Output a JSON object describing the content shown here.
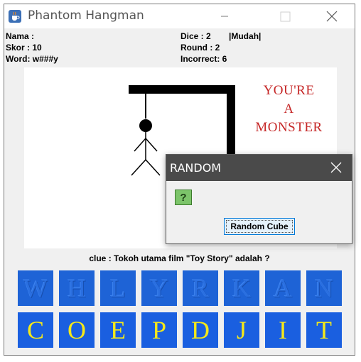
{
  "window": {
    "title": "Phantom Hangman",
    "icon": "java-cup-icon"
  },
  "info": {
    "nama": "Nama :",
    "skor": "Skor : 10",
    "word": "Word: w###y",
    "dice": "Dice : 2",
    "difficulty": "|Mudah|",
    "round": "Round : 2",
    "incorrect": "Incorrect: 6"
  },
  "canvas": {
    "message_lines": [
      "YOU'RE",
      "A",
      "MONSTER"
    ]
  },
  "clue": "clue : Tokoh utama film \"Toy Story\" adalah ?",
  "letters": {
    "row1": [
      "W",
      "H",
      "L",
      "Y",
      "R",
      "K",
      "A",
      "N"
    ],
    "row2": [
      "C",
      "O",
      "E",
      "P",
      "D",
      "J",
      "I",
      "T"
    ]
  },
  "dialog": {
    "title": "RANDOM",
    "icon_text": "?",
    "button": "Random Cube"
  },
  "colors": {
    "tile_blue": "#1a5fe0",
    "letter_yellow": "#f4e81a",
    "monster_red": "#c62828"
  }
}
